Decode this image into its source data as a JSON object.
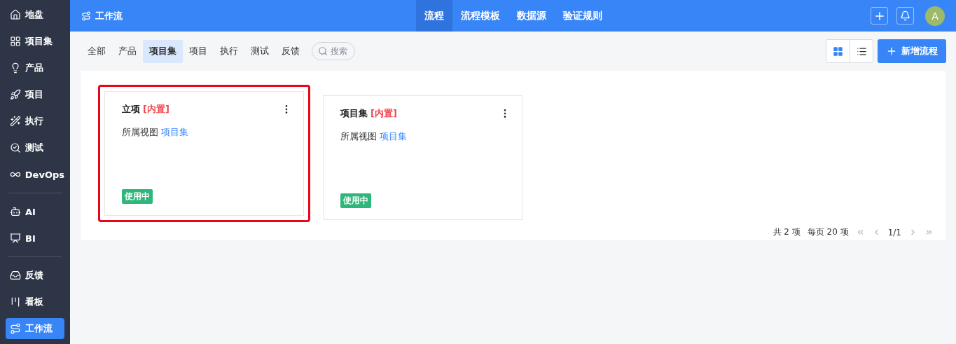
{
  "sidebar": {
    "items": [
      {
        "label": "地盘",
        "selected": false
      },
      {
        "label": "项目集",
        "selected": false
      },
      {
        "label": "产品",
        "selected": false
      },
      {
        "label": "项目",
        "selected": false
      },
      {
        "label": "执行",
        "selected": false
      },
      {
        "label": "测试",
        "selected": false
      },
      {
        "label": "DevOps",
        "selected": false
      },
      {
        "kind": "divider"
      },
      {
        "label": "AI",
        "selected": false
      },
      {
        "label": "BI",
        "selected": false
      },
      {
        "kind": "divider"
      },
      {
        "label": "反馈",
        "selected": false
      },
      {
        "label": "看板",
        "selected": false
      },
      {
        "label": "工作流",
        "selected": true
      }
    ]
  },
  "header": {
    "title": "工作流",
    "nav": [
      {
        "label": "流程",
        "selected": true
      },
      {
        "label": "流程模板",
        "selected": false
      },
      {
        "label": "数据源",
        "selected": false
      },
      {
        "label": "验证规则",
        "selected": false
      }
    ],
    "avatar": "A"
  },
  "filters": [
    {
      "label": "全部",
      "selected": false
    },
    {
      "label": "产品",
      "selected": false
    },
    {
      "label": "项目集",
      "selected": true
    },
    {
      "label": "项目",
      "selected": false
    },
    {
      "label": "执行",
      "selected": false
    },
    {
      "label": "测试",
      "selected": false
    },
    {
      "label": "反馈",
      "selected": false
    }
  ],
  "search": {
    "placeholder": "搜索"
  },
  "view_toggle": [
    {
      "selected": true
    },
    {
      "selected": false
    }
  ],
  "add_button": "新增流程",
  "cards": [
    {
      "name": "立项",
      "tag": "[内置]",
      "view_label": "所属视图",
      "view": "项目集",
      "status": "使用中",
      "highlighted": true
    },
    {
      "name": "项目集",
      "tag": "[内置]",
      "view_label": "所属视图",
      "view": "项目集",
      "status": "使用中",
      "highlighted": false
    }
  ],
  "pagination": {
    "total": "共 2 项",
    "per_page": "每页 20 项",
    "page": "1/1"
  }
}
